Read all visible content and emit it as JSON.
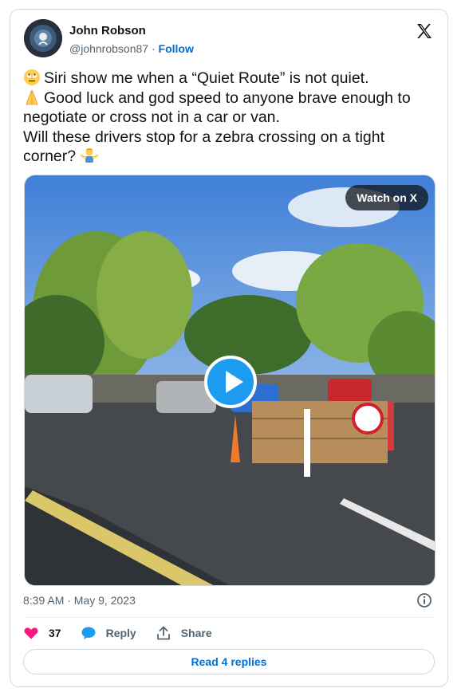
{
  "author": {
    "name": "John Robson",
    "handle": "@johnrobson87",
    "separator": "·",
    "follow_label": "Follow"
  },
  "icons": {
    "platform": "x-logo-icon",
    "emoji_1": "face-with-rolling-eyes-emoji",
    "emoji_2": "folded-hands-emoji",
    "emoji_3": "person-shrugging-emoji",
    "play": "play-icon",
    "info": "info-icon",
    "like": "heart-icon",
    "reply": "speech-bubble-icon",
    "share": "share-upload-icon"
  },
  "tweet": {
    "line1": "Siri show me when a “Quiet Route” is not quiet.",
    "line2": "Good luck and god speed to anyone brave enough to negotiate or cross not in a car or van.",
    "line3": "Will these drivers stop for a zebra crossing on a tight corner?"
  },
  "media": {
    "watch_label": "Watch on X"
  },
  "meta": {
    "timestamp": "8:39 AM · May 9, 2023"
  },
  "actions": {
    "like_count": "37",
    "reply_label": "Reply",
    "share_label": "Share"
  },
  "footer": {
    "read_replies_label": "Read 4 replies"
  },
  "colors": {
    "accent": "#1d9bf0",
    "link": "#006fd6",
    "like": "#f91880",
    "text": "#0f1419",
    "muted": "#536471"
  }
}
